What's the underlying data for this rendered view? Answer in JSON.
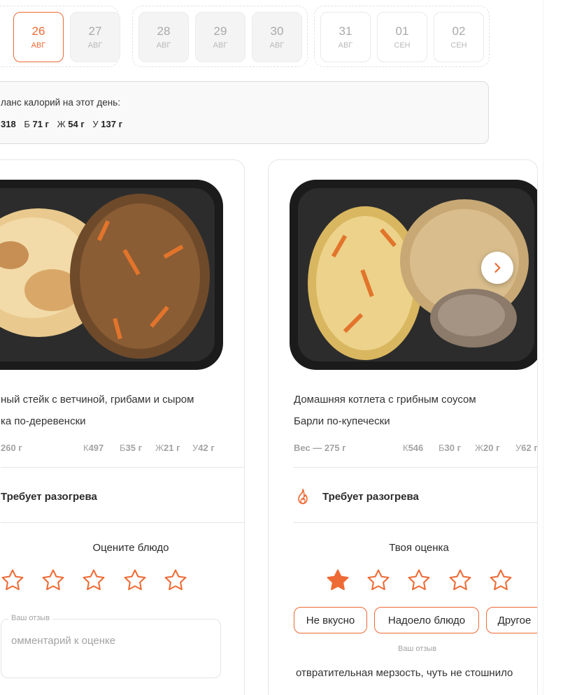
{
  "dates": {
    "groups": [
      {
        "items": [
          {
            "day": "26",
            "month": "АВГ",
            "state": "active"
          },
          {
            "day": "27",
            "month": "АВГ",
            "state": "past"
          }
        ]
      },
      {
        "items": [
          {
            "day": "28",
            "month": "АВГ",
            "state": "past"
          },
          {
            "day": "29",
            "month": "АВГ",
            "state": "past"
          },
          {
            "day": "30",
            "month": "АВГ",
            "state": "past"
          }
        ]
      },
      {
        "items": [
          {
            "day": "31",
            "month": "АВГ",
            "state": "future"
          },
          {
            "day": "01",
            "month": "СЕН",
            "state": "future"
          },
          {
            "day": "02",
            "month": "СЕН",
            "state": "future"
          }
        ]
      }
    ]
  },
  "balance": {
    "title": "ланс калорий на этот день:",
    "kcal": "318",
    "protein_label": "Б",
    "protein": "71 г",
    "fat_label": "Ж",
    "fat": "54 г",
    "carb_label": "У",
    "carb": "137 г"
  },
  "cards": [
    {
      "dish_main": "ный стейк с ветчиной, грибами и сыром",
      "dish_side": "ка по-деревенски",
      "weight": "260 г",
      "k_label": "К",
      "k": "497",
      "b_label": "Б",
      "b": "35 г",
      "zh_label": "Ж",
      "zh": "21 г",
      "u_label": "У",
      "u": "42 г",
      "heat_text": "Требует разогрева",
      "rate_title": "Оцените блюдо",
      "rating": 0,
      "comment_label": "Ваш отзыв",
      "comment_placeholder": "омментарий к оценке"
    },
    {
      "dish_main": "Домашняя котлета с грибным соусом",
      "dish_side": "Барли по-купечески",
      "weight": "Вес — 275 г",
      "k_label": "К",
      "k": "546",
      "b_label": "Б",
      "b": "30 г",
      "zh_label": "Ж",
      "zh": "20 г",
      "u_label": "У",
      "u": "62 г",
      "heat_text": "Требует разогрева",
      "rate_title": "Твоя оценка",
      "rating": 1,
      "chips": [
        "Не вкусно",
        "Надоело блюдо",
        "Другое"
      ],
      "feedback_label": "Ваш отзыв",
      "feedback_text": "отвратительная мерзость, чуть не стошнило"
    }
  ],
  "colors": {
    "accent": "#ee6a34",
    "muted": "#a3a3a3",
    "border": "#e6e6e6"
  },
  "icons": {
    "next": "chevron-right-icon",
    "heat": "flame-icon",
    "star": "star-icon"
  }
}
